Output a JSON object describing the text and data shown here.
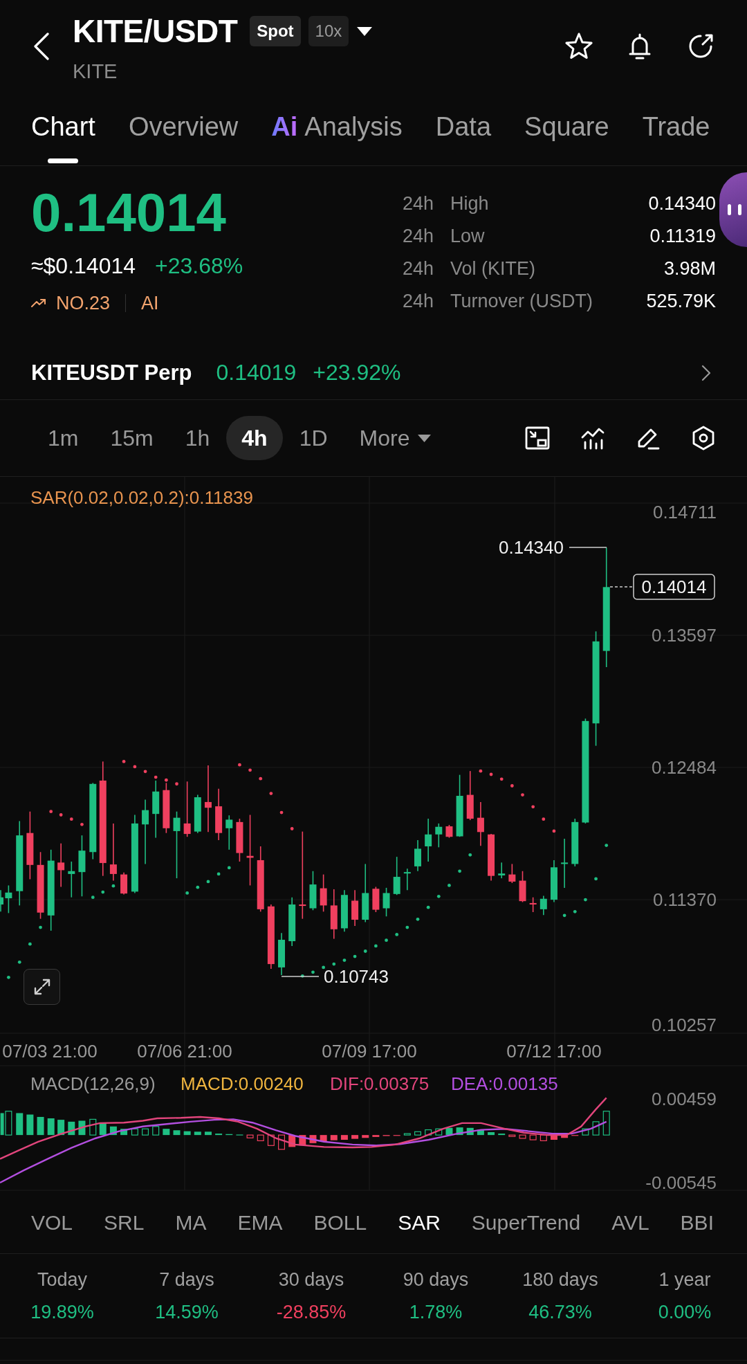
{
  "header": {
    "title": "KITE/USDT",
    "badges": [
      {
        "label": "Spot",
        "kind": "market"
      },
      {
        "label": "10x",
        "kind": "leverage"
      }
    ],
    "subtitle": "KITE",
    "favorited": false
  },
  "tabs": [
    {
      "label": "Chart",
      "selected": true
    },
    {
      "label": "Overview",
      "selected": false
    },
    {
      "label": "Analysis",
      "badge": "Ai",
      "selected": false
    },
    {
      "label": "Data",
      "selected": false
    },
    {
      "label": "Square",
      "selected": false
    },
    {
      "label": "Trade",
      "selected": false
    }
  ],
  "ticker": {
    "last_price": "0.14014",
    "usd_price": "≈$0.14014",
    "change": "+23.68%",
    "rank": "NO.23",
    "tag": "AI",
    "stats": [
      {
        "period": "24h",
        "label": "High",
        "value": "0.14340"
      },
      {
        "period": "24h",
        "label": "Low",
        "value": "0.11319"
      },
      {
        "period": "24h",
        "label": "Vol (KITE)",
        "value": "3.98M"
      },
      {
        "period": "24h",
        "label": "Turnover (USDT)",
        "value": "525.79K"
      }
    ]
  },
  "perp": {
    "name": "KITEUSDT Perp",
    "price": "0.14019",
    "change": "+23.92%"
  },
  "intervals": [
    {
      "label": "1m",
      "selected": false
    },
    {
      "label": "15m",
      "selected": false
    },
    {
      "label": "1h",
      "selected": false
    },
    {
      "label": "4h",
      "selected": true
    },
    {
      "label": "1D",
      "selected": false
    }
  ],
  "more_label": "More",
  "chart": {
    "indicator_label": "SAR(0.02,0.02,0.2):0.11839",
    "price_ticks": [
      "0.14711",
      "0.13597",
      "0.12484",
      "0.11370",
      "0.10257"
    ],
    "time_ticks": [
      "07/03 21:00",
      "07/06 21:00",
      "07/09 17:00",
      "07/12 17:00"
    ],
    "high_marker": "0.14340",
    "low_marker": "0.10743",
    "last_price_tag": "0.14014"
  },
  "macd": {
    "legend": [
      {
        "text": "MACD(12,26,9)",
        "color": "#9a9a9a"
      },
      {
        "text": "MACD:0.00240",
        "color": "#f0b53f"
      },
      {
        "text": "DIF:0.00375",
        "color": "#e2457c"
      },
      {
        "text": "DEA:0.00135",
        "color": "#b34fe0"
      }
    ],
    "ticks": [
      "0.00459",
      "-0.00545"
    ]
  },
  "indicators": [
    {
      "label": "VOL",
      "selected": false
    },
    {
      "label": "SRL",
      "selected": false
    },
    {
      "label": "MA",
      "selected": false
    },
    {
      "label": "EMA",
      "selected": false
    },
    {
      "label": "BOLL",
      "selected": false
    },
    {
      "label": "SAR",
      "selected": true
    },
    {
      "label": "SuperTrend",
      "selected": false
    },
    {
      "label": "AVL",
      "selected": false
    },
    {
      "label": "BBI",
      "selected": false
    }
  ],
  "performance": [
    {
      "period": "Today",
      "change": "19.89%",
      "color": "#1fbf83"
    },
    {
      "period": "7 days",
      "change": "14.59%",
      "color": "#1fbf83"
    },
    {
      "period": "30 days",
      "change": "-28.85%",
      "color": "#f0405f"
    },
    {
      "period": "90 days",
      "change": "1.78%",
      "color": "#1fbf83"
    },
    {
      "period": "180 days",
      "change": "46.73%",
      "color": "#1fbf83"
    },
    {
      "period": "1 year",
      "change": "0.00%",
      "color": "#1fbf83"
    }
  ]
}
